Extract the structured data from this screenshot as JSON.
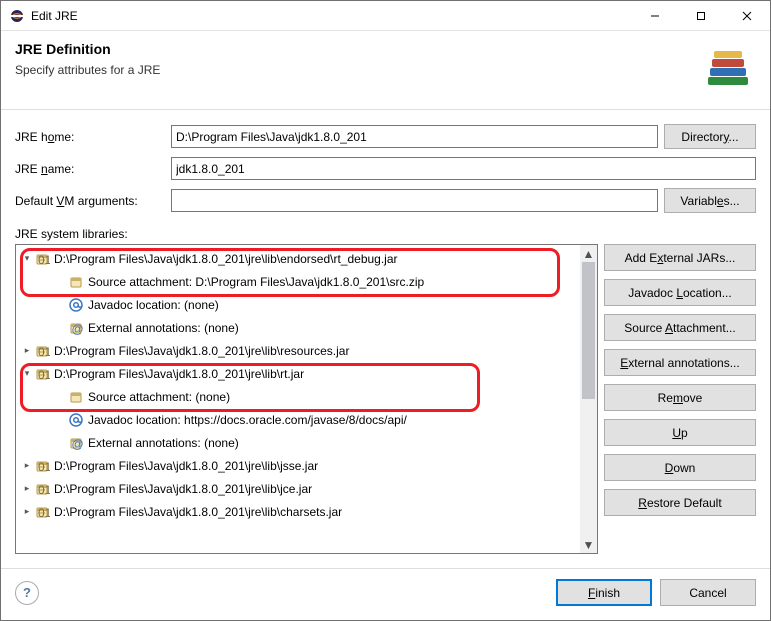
{
  "window": {
    "title": "Edit JRE"
  },
  "header": {
    "title": "JRE Definition",
    "subtitle": "Specify attributes for a JRE"
  },
  "form": {
    "jre_home_label": "JRE home:",
    "jre_home_value": "D:\\Program Files\\Java\\jdk1.8.0_201",
    "directory_btn": "Directory...",
    "jre_name_label": "JRE name:",
    "jre_name_value": "jdk1.8.0_201",
    "default_vm_label": "Default VM arguments:",
    "default_vm_value": "",
    "variables_btn": "Variables...",
    "syslib_label": "JRE system libraries:"
  },
  "tree": {
    "items": [
      {
        "lvl": 0,
        "twisty": "open",
        "icon": "jar",
        "text": "D:\\Program Files\\Java\\jdk1.8.0_201\\jre\\lib\\endorsed\\rt_debug.jar"
      },
      {
        "lvl": 1,
        "twisty": "",
        "icon": "src",
        "text": "Source attachment: D:\\Program Files\\Java\\jdk1.8.0_201\\src.zip"
      },
      {
        "lvl": 1,
        "twisty": "",
        "icon": "at",
        "text": "Javadoc location: (none)"
      },
      {
        "lvl": 1,
        "twisty": "",
        "icon": "ann",
        "text": "External annotations: (none)"
      },
      {
        "lvl": 0,
        "twisty": "closed",
        "icon": "jar",
        "text": "D:\\Program Files\\Java\\jdk1.8.0_201\\jre\\lib\\resources.jar"
      },
      {
        "lvl": 0,
        "twisty": "open",
        "icon": "jar",
        "text": "D:\\Program Files\\Java\\jdk1.8.0_201\\jre\\lib\\rt.jar"
      },
      {
        "lvl": 1,
        "twisty": "",
        "icon": "src",
        "text": "Source attachment: (none)"
      },
      {
        "lvl": 1,
        "twisty": "",
        "icon": "at",
        "text": "Javadoc location: https://docs.oracle.com/javase/8/docs/api/"
      },
      {
        "lvl": 1,
        "twisty": "",
        "icon": "ann",
        "text": "External annotations: (none)"
      },
      {
        "lvl": 0,
        "twisty": "closed",
        "icon": "jar",
        "text": "D:\\Program Files\\Java\\jdk1.8.0_201\\jre\\lib\\jsse.jar"
      },
      {
        "lvl": 0,
        "twisty": "closed",
        "icon": "jar",
        "text": "D:\\Program Files\\Java\\jdk1.8.0_201\\jre\\lib\\jce.jar"
      },
      {
        "lvl": 0,
        "twisty": "closed",
        "icon": "jar",
        "text": "D:\\Program Files\\Java\\jdk1.8.0_201\\jre\\lib\\charsets.jar"
      }
    ]
  },
  "side": {
    "add_ext": "Add External JARs...",
    "javadoc": "Javadoc Location...",
    "src_attach": "Source Attachment...",
    "ext_ann": "External annotations...",
    "remove": "Remove",
    "up": "Up",
    "down": "Down",
    "restore": "Restore Default"
  },
  "footer": {
    "finish": "Finish",
    "cancel": "Cancel"
  }
}
